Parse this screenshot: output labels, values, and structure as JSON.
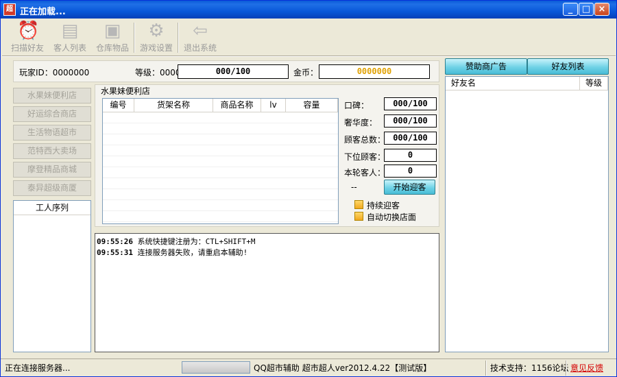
{
  "window": {
    "title": "正在加载...",
    "icon_text": "超"
  },
  "title_buttons": {
    "minimize": "_",
    "maximize": "□",
    "close": "×"
  },
  "toolbar": [
    {
      "label": "扫描好友",
      "icon": "alarm-clock-icon",
      "glyph": "⏰"
    },
    {
      "label": "客人列表",
      "icon": "notebook-icon",
      "glyph": "▤"
    },
    {
      "label": "仓库物品",
      "icon": "safe-box-icon",
      "glyph": "▣"
    },
    {
      "label": "游戏设置",
      "icon": "gear-icon",
      "glyph": "⚙"
    },
    {
      "label": "退出系统",
      "icon": "exit-door-icon",
      "glyph": "⇦"
    }
  ],
  "player": {
    "id_label": "玩家ID：0000000",
    "level_label": "等级：0000",
    "level_value": "000/100",
    "gold_label": "金币：",
    "gold_value": "0000000"
  },
  "stores": [
    "水果妹便利店",
    "好运综合商店",
    "生活物语超市",
    "范特西大卖场",
    "摩登精品商城",
    "泰异超级商厦"
  ],
  "workers": {
    "header": "工人序列"
  },
  "store_panel": {
    "title": "水果妹便利店",
    "columns": [
      "编号",
      "货架名称",
      "商品名称",
      "lv",
      "容量"
    ]
  },
  "stats": [
    {
      "label": "口碑：",
      "value": "000/100"
    },
    {
      "label": "奢华度：",
      "value": "000/100"
    },
    {
      "label": "顾客总数：",
      "value": "000/100"
    },
    {
      "label": "下位顾客：",
      "value": "0"
    },
    {
      "label": "本轮客人：",
      "value": "0"
    }
  ],
  "dash": "--",
  "start_button": "开始迎客",
  "options": [
    {
      "label": "持续迎客",
      "checked": false
    },
    {
      "label": "自动切换店面",
      "checked": false
    }
  ],
  "log": [
    {
      "time": "09:55:26",
      "text": "系统快捷键注册为：CTL+SHIFT+M"
    },
    {
      "time": "09:55:31",
      "text": "连接服务器失败，请重启本辅助!"
    }
  ],
  "right_tabs": {
    "sponsor": "赞助商广告",
    "friends": "好友列表"
  },
  "friend_list": {
    "columns": [
      "好友名",
      "等级"
    ]
  },
  "status_bar": {
    "connecting": "正在连接服务器...",
    "version": "QQ超市辅助 超市超人ver2012.4.22【测试版】",
    "support": "技术支持：1156论坛",
    "feedback": "意见反馈"
  },
  "colors": {
    "gold": "#e0a100",
    "feedback": "#d40000",
    "title_bar": "#0958d9"
  }
}
